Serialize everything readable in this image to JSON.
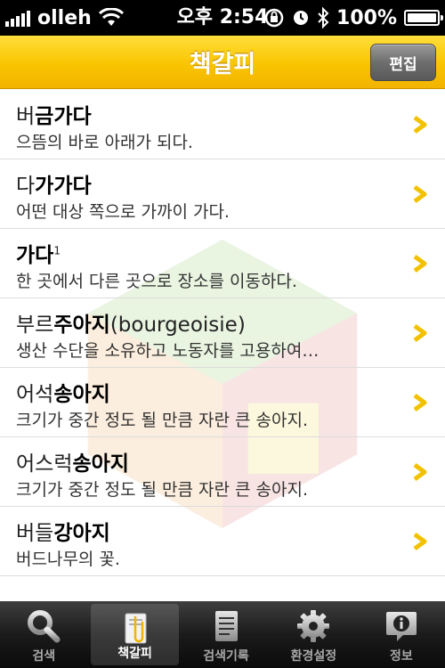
{
  "status_bar": {
    "carrier": "olleh",
    "time": "오후 2:54",
    "battery": "100%",
    "battery_level": 1.0
  },
  "nav": {
    "title": "책갈피",
    "edit_label": "편집"
  },
  "list": {
    "items": [
      {
        "prefix": "버",
        "highlight": "금가다",
        "suffix": "",
        "sup": "",
        "subtitle": "으뜸의 바로 아래가 되다."
      },
      {
        "prefix": "다",
        "highlight": "가가다",
        "suffix": "",
        "sup": "",
        "subtitle": "어떤 대상 쪽으로 가까이 가다."
      },
      {
        "prefix": "",
        "highlight": "가다",
        "suffix": "",
        "sup": "1",
        "subtitle": "한 곳에서 다른 곳으로 장소를 이동하다."
      },
      {
        "prefix": "부르",
        "highlight": "주아지",
        "suffix": "(bourgeoisie)",
        "sup": "",
        "subtitle": "생산 수단을 소유하고 노동자를 고용하여…"
      },
      {
        "prefix": "어석",
        "highlight": "송아지",
        "suffix": "",
        "sup": "",
        "subtitle": "크기가 중간 정도 될 만큼 자란 큰 송아지."
      },
      {
        "prefix": "어스럭",
        "highlight": "송아지",
        "suffix": "",
        "sup": "",
        "subtitle": "크기가 중간 정도 될 만큼 자란 큰 송아지."
      },
      {
        "prefix": "버들",
        "highlight": "강아지",
        "suffix": "",
        "sup": "",
        "subtitle": "버드나무의 꽃."
      }
    ]
  },
  "tabs": [
    {
      "label": "검색",
      "icon": "search-icon",
      "active": false
    },
    {
      "label": "책갈피",
      "icon": "bookmark-icon",
      "active": true
    },
    {
      "label": "검색기록",
      "icon": "history-icon",
      "active": false
    },
    {
      "label": "환경설정",
      "icon": "gear-icon",
      "active": false
    },
    {
      "label": "정보",
      "icon": "info-icon",
      "active": false
    }
  ],
  "colors": {
    "nav_yellow": "#f9c400",
    "chevron_yellow": "#f2c200"
  }
}
